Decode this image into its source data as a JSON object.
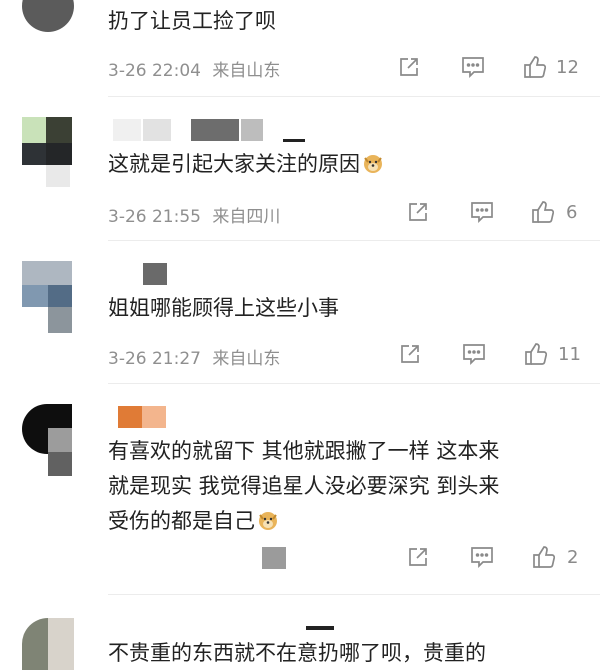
{
  "comments": [
    {
      "text": "扔了让员工捡了呗",
      "time": "3-26 22:04",
      "location": "来自山东",
      "likes": "12"
    },
    {
      "text": "这就是引起大家关注的原因",
      "time": "3-26 21:55",
      "location": "来自四川",
      "likes": "6"
    },
    {
      "text": "姐姐哪能顾得上这些小事",
      "time": "3-26 21:27",
      "location": "来自山东",
      "likes": "11"
    },
    {
      "text1": "有喜欢的就留下 其他就跟撇了一样 这本来",
      "text2": "就是现实 我觉得追星人没必要深究 到头来",
      "text3": "受伤的都是自己",
      "likes": "2"
    },
    {
      "text": "不贵重的东西就不在意扔哪了呗，贵重的"
    }
  ],
  "icons": {
    "repost": "repost-icon",
    "comment": "comment-icon",
    "like": "like-icon",
    "emoji": "doge-emoji-icon"
  },
  "colors": {
    "meta": "#8f8f8f",
    "text": "#222222",
    "divider": "#ececec"
  }
}
